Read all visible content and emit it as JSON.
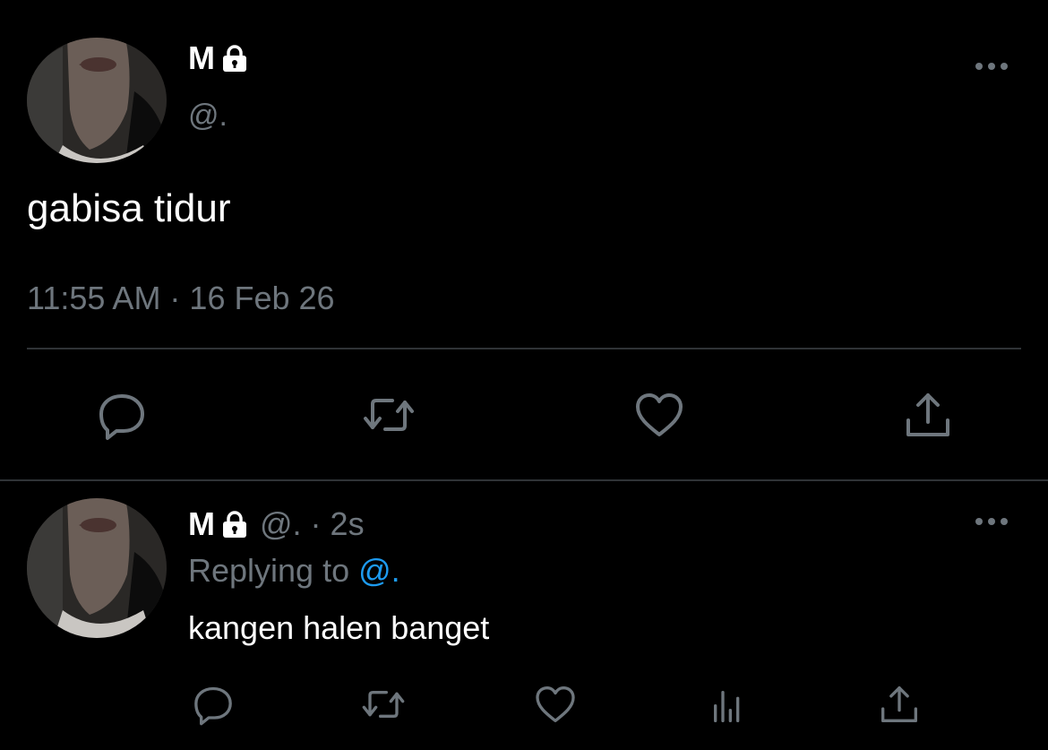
{
  "main_tweet": {
    "display_name": "M",
    "handle": "@.",
    "text": "gabisa tidur",
    "timestamp": "11:55 AM · 16 Feb 26",
    "actions": {
      "reply_icon": "speech-bubble",
      "retweet_icon": "retweet-arrows",
      "like_icon": "heart-outline",
      "share_icon": "share-upload"
    }
  },
  "reply_tweet": {
    "display_name": "M",
    "handle": "@.",
    "separator": "·",
    "time_ago": "2s",
    "replying_prefix": "Replying to",
    "replying_to": "@.",
    "text": "kangen halen banget",
    "actions": {
      "reply_icon": "speech-bubble",
      "retweet_icon": "retweet-arrows",
      "like_icon": "heart-outline",
      "analytics_icon": "bar-chart",
      "share_icon": "share-upload"
    }
  },
  "colors": {
    "background": "#000000",
    "text_primary": "#ffffff",
    "text_secondary": "#6e767d",
    "accent": "#1d9bf0",
    "divider": "#2f3336"
  }
}
